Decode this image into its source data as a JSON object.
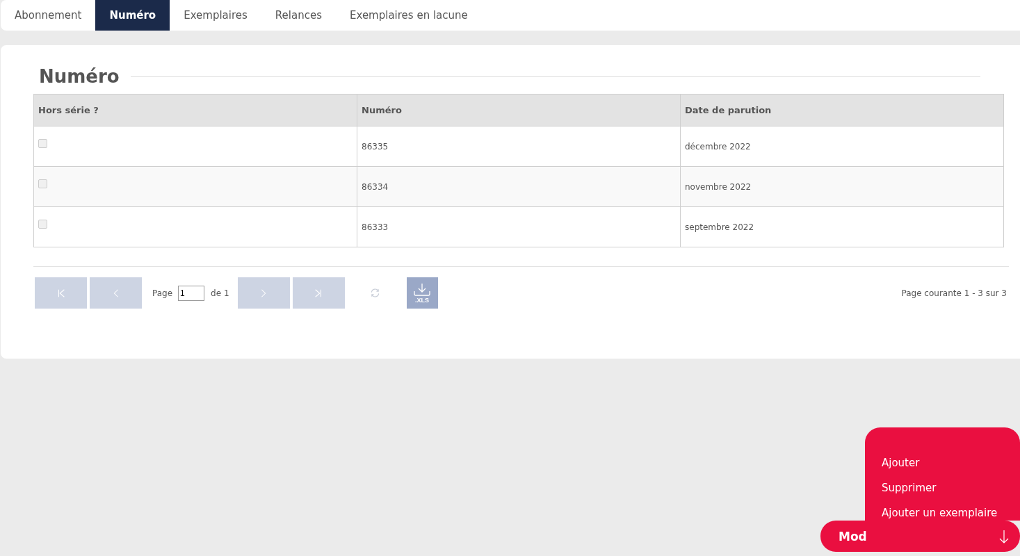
{
  "tabs": [
    {
      "label": "Abonnement",
      "selected": false
    },
    {
      "label": "Numéro",
      "selected": true
    },
    {
      "label": "Exemplaires",
      "selected": false
    },
    {
      "label": "Relances",
      "selected": false
    },
    {
      "label": "Exemplaires en lacune",
      "selected": false
    }
  ],
  "section": {
    "title": "Numéro"
  },
  "table": {
    "columns": [
      "Hors série ?",
      "Numéro",
      "Date de parution"
    ],
    "rows": [
      {
        "hors_serie": false,
        "numero": "86335",
        "date": "décembre 2022"
      },
      {
        "hors_serie": false,
        "numero": "86334",
        "date": "novembre 2022"
      },
      {
        "hors_serie": false,
        "numero": "86333",
        "date": "septembre 2022"
      }
    ]
  },
  "pager": {
    "nav_buttons": [
      {
        "kind": "first",
        "disabled": true
      },
      {
        "kind": "prev",
        "disabled": true
      },
      {
        "kind": "next",
        "disabled": true
      },
      {
        "kind": "last",
        "disabled": true
      }
    ],
    "page_label": "Page",
    "page_value": "1",
    "of_label": "de 1",
    "xls_label": ".XLS",
    "info": "Page courante 1 - 3 sur 3"
  },
  "action_menu": {
    "label": "Mod",
    "expanded": true,
    "items": [
      "Ajouter",
      "Supprimer",
      "Ajouter un exemplaire"
    ]
  }
}
